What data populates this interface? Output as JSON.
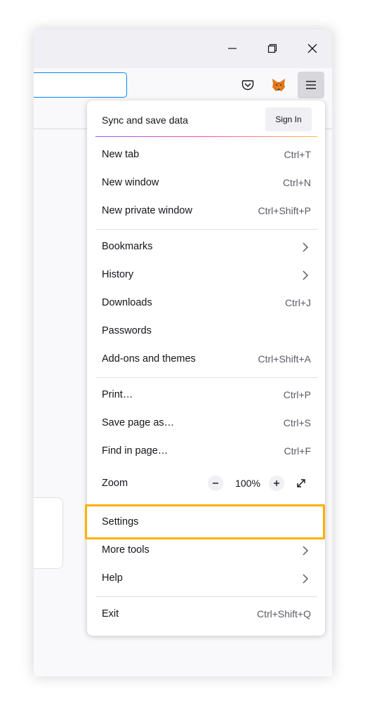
{
  "window": {
    "controls": {
      "minimize_icon": "minimize-icon",
      "restore_icon": "restore-icon",
      "close_icon": "close-icon"
    }
  },
  "toolbar": {
    "urlbar_value": "",
    "pocket_icon": "pocket-icon",
    "extension_icon": "metamask-fox-icon",
    "menu_icon": "hamburger-menu-icon"
  },
  "menu": {
    "sync": {
      "label": "Sync and save data",
      "button": "Sign In"
    },
    "group1": [
      {
        "label": "New tab",
        "shortcut": "Ctrl+T"
      },
      {
        "label": "New window",
        "shortcut": "Ctrl+N"
      },
      {
        "label": "New private window",
        "shortcut": "Ctrl+Shift+P"
      }
    ],
    "group2": [
      {
        "label": "Bookmarks",
        "shortcut": "",
        "submenu": true
      },
      {
        "label": "History",
        "shortcut": "",
        "submenu": true
      },
      {
        "label": "Downloads",
        "shortcut": "Ctrl+J"
      },
      {
        "label": "Passwords",
        "shortcut": ""
      },
      {
        "label": "Add-ons and themes",
        "shortcut": "Ctrl+Shift+A"
      }
    ],
    "group3": [
      {
        "label": "Print…",
        "shortcut": "Ctrl+P"
      },
      {
        "label": "Save page as…",
        "shortcut": "Ctrl+S"
      },
      {
        "label": "Find in page…",
        "shortcut": "Ctrl+F"
      }
    ],
    "zoom": {
      "label": "Zoom",
      "value": "100%",
      "minus": "−",
      "plus": "+"
    },
    "group4": [
      {
        "label": "Settings",
        "shortcut": "",
        "highlighted": true
      },
      {
        "label": "More tools",
        "shortcut": "",
        "submenu": true
      },
      {
        "label": "Help",
        "shortcut": "",
        "submenu": true
      }
    ],
    "exit": {
      "label": "Exit",
      "shortcut": "Ctrl+Shift+Q"
    }
  },
  "colors": {
    "highlight_border": "#ffb000",
    "urlbar_focus": "#0a84ff",
    "gradient": [
      "#9059ff",
      "#ff4aa2",
      "#ffbd4f"
    ]
  }
}
